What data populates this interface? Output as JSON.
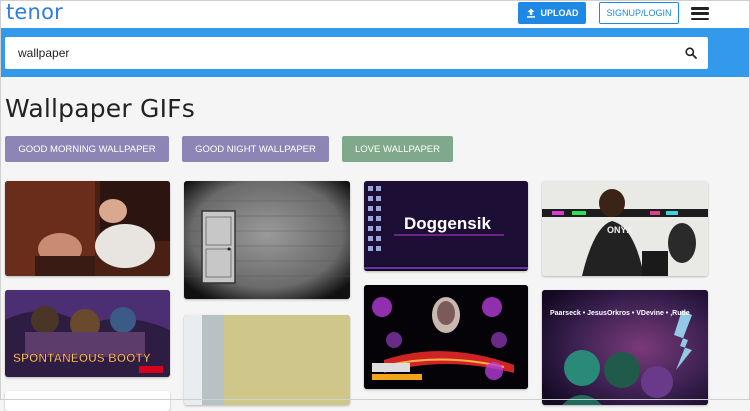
{
  "header": {
    "logo": "tenor",
    "upload_label": "UPLOAD",
    "signup_label": "SIGNUP/LOGIN"
  },
  "search": {
    "value": "wallpaper"
  },
  "page": {
    "title": "Wallpaper GIFs"
  },
  "chips": [
    {
      "label": "GOOD MORNING WALLPAPER",
      "color": "#8d86b5"
    },
    {
      "label": "GOOD NIGHT WALLPAPER",
      "color": "#8d86b5"
    },
    {
      "label": "LOVE WALLPAPER",
      "color": "#7fa98a"
    }
  ],
  "gifs": {
    "doggensik": "Doggensik",
    "onyx": "ONYX",
    "spontaneous": "SPONTANEOUS BOOTY",
    "names": "Paarseck • JesusOrkros • VDevine • ,Rude"
  },
  "colors": {
    "brand": "#2f7de1",
    "search_band": "#3399ea",
    "upload_bg": "#1e88e5"
  }
}
